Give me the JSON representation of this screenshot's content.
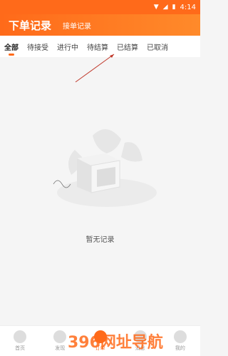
{
  "status_bar": {
    "time": "4:14"
  },
  "header": {
    "title": "下单记录",
    "subtitle": "接单记录"
  },
  "tabs": [
    {
      "label": "全部",
      "active": true
    },
    {
      "label": "待接受",
      "active": false
    },
    {
      "label": "进行中",
      "active": false
    },
    {
      "label": "待结算",
      "active": false
    },
    {
      "label": "已结算",
      "active": false
    },
    {
      "label": "已取消",
      "active": false
    }
  ],
  "empty": {
    "text": "暂无记录"
  },
  "bottom_nav": [
    {
      "label": "首页"
    },
    {
      "label": "发现"
    },
    {
      "label": "订单",
      "active": true
    },
    {
      "label": "消息"
    },
    {
      "label": "我的"
    }
  ],
  "watermark": "396网址导航",
  "colors": {
    "accent": "#ff6a1a"
  }
}
